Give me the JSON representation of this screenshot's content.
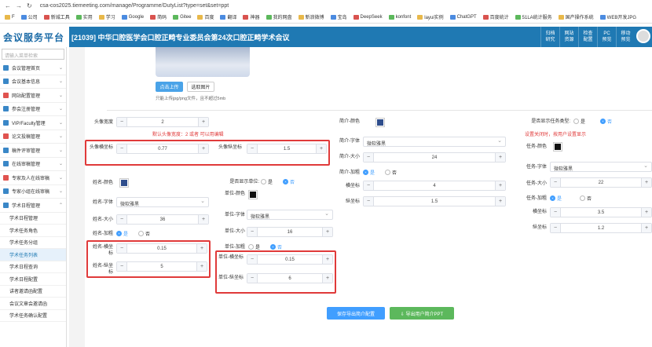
{
  "browser": {
    "url": "csa-cos2025.tiemeeting.com/manage/Programme/DutyList?type=set&set=ppt"
  },
  "bookmarks": [
    "F",
    "公司",
    "新城工具",
    "实用",
    "学习",
    "Google",
    "简码",
    "Gitee",
    "百度",
    "翻译",
    "神器",
    "我的网盘",
    "新浪微博",
    "宝岛",
    "DeepSeek",
    "konfont",
    "layui实例",
    "ChatGPT",
    "百度统计",
    "51LA统计服务",
    "国产操作系统",
    "WEB开发JPG"
  ],
  "header": {
    "logo": "会议服务平台",
    "title": "[21039] 中华口腔医学会口腔正畸专业委员会第24次口腔正畸学术会议",
    "nav": [
      [
        "归档",
        "研究"
      ],
      [
        "网站",
        "资源"
      ],
      [
        "检查",
        "配置"
      ],
      [
        "PC",
        "预览"
      ],
      [
        "移动",
        "预览"
      ]
    ]
  },
  "sidebar": {
    "search_placeholder": "请输入菜单检索",
    "items": [
      {
        "label": "会议管理首页",
        "color": "#3a87c7"
      },
      {
        "label": "会议基本信息",
        "color": "#3a87c7"
      },
      {
        "label": "网站配置管理",
        "color": "#e0534f"
      },
      {
        "label": "参会注册管理",
        "color": "#3a87c7"
      },
      {
        "label": "VIP/Faculty管理",
        "color": "#3a87c7"
      },
      {
        "label": "论文投稿管理",
        "color": "#e0534f"
      },
      {
        "label": "稿件评审管理",
        "color": "#3a87c7"
      },
      {
        "label": "在线审稿管理",
        "color": "#3a87c7"
      },
      {
        "label": "专家及人在线审稿",
        "color": "#e0534f"
      },
      {
        "label": "专家小组在线审稿",
        "color": "#3a87c7"
      },
      {
        "label": "学术日程管理",
        "color": "#3a87c7"
      }
    ],
    "subitems": [
      "学术日程管理",
      "学术任务角色",
      "学术任务分组",
      "学术任务列表",
      "学术日程查询",
      "学术日程配置",
      "讲者邀请函配置",
      "会议文章会邀请函",
      "学术任务确认配置"
    ],
    "active_sub": "学术任务列表"
  },
  "upload": {
    "upload_btn": "点击上传",
    "select_btn": "选取图片",
    "hint": "只能上传jpg/png文件，且不超过5mb"
  },
  "form": {
    "avatar_width_label": "头像宽度",
    "avatar_width": "2",
    "warn1": "默认头像宽度：2 或者 可以用编辑",
    "avatar_x_label": "头像横坐标",
    "avatar_x": "0.77",
    "avatar_y_label": "头像纵坐标",
    "avatar_y": "1.5",
    "name_color_label": "姓名-颜色",
    "name_font_label": "姓名-字体",
    "name_font": "微软雅黑",
    "name_size_label": "姓名-大小",
    "name_size": "36",
    "name_bold_label": "姓名-加粗",
    "yes": "是",
    "no": "否",
    "name_x_label": "姓名-横坐标",
    "name_x": "0.15",
    "name_y_label": "姓名-纵坐标",
    "name_y": "5",
    "show_unit_label": "是否显示单位:",
    "unit_color_label": "单位-颜色",
    "unit_font_label": "单位-字体",
    "unit_font": "微软雅黑",
    "unit_size_label": "单位-大小",
    "unit_size": "16",
    "unit_bold_label": "单位-加粗",
    "unit_x_label": "单位-横坐标",
    "unit_x": "0.15",
    "unit_y_label": "单位-纵坐标",
    "unit_y": "6",
    "intro_color_label": "简介-颜色",
    "intro_font_label": "简介-字体",
    "intro_font": "微软雅黑",
    "intro_size_label": "简介-大小",
    "intro_size": "24",
    "intro_bold_label": "简介-加粗",
    "intro_x_label": "横坐标",
    "intro_x": "4",
    "intro_y_label": "纵坐标",
    "intro_y": "1.5",
    "show_task_label": "是否显示任务类型:",
    "warn2": "设置关闭时，按用户设置显示",
    "task_color_label": "任务-颜色",
    "task_font_label": "任务-字体",
    "task_font": "微软雅黑",
    "task_size_label": "任务-大小",
    "task_size": "22",
    "task_bold_label": "任务-加粗",
    "task_x_label": "横坐标",
    "task_x": "3.5",
    "task_y_label": "纵坐标",
    "task_y": "1.2"
  },
  "buttons": {
    "save": "保存导出简介配置",
    "export": "⇩ 导出用户简介PPT"
  },
  "colors": {
    "primary": "#409eff",
    "header": "#1f79b3",
    "swatch_blue": "#2f4e8c",
    "swatch_black": "#111111",
    "red": "#e03a3a",
    "green": "#5cb85c"
  }
}
